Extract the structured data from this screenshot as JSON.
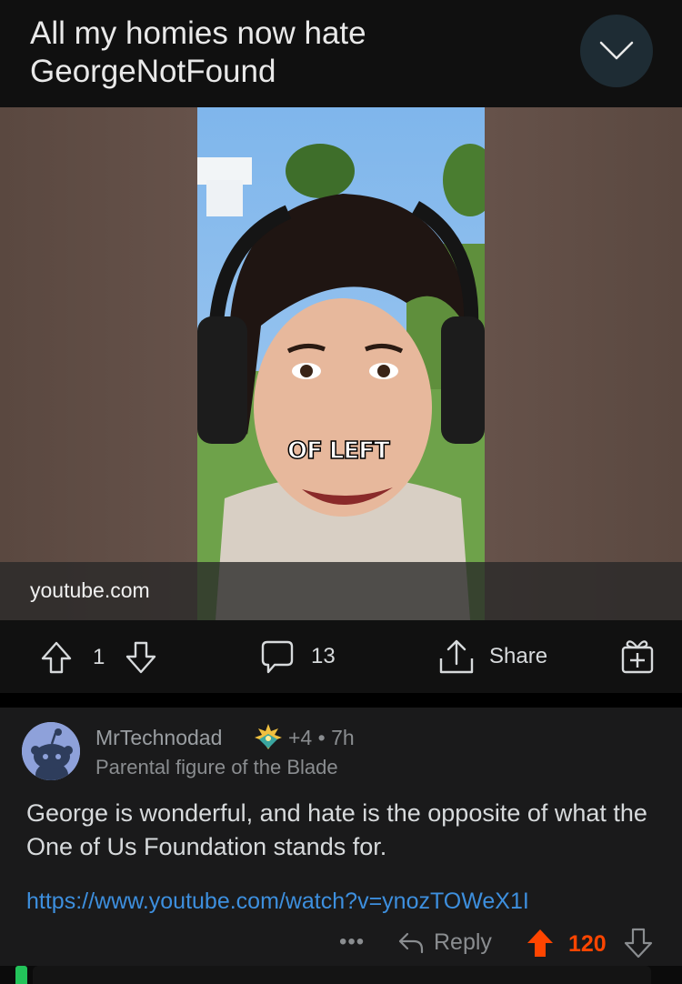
{
  "post": {
    "title": "All my homies now hate GeorgeNotFound",
    "link_domain": "youtube.com",
    "video_caption": "OF LEFT",
    "upvote_count": "1",
    "comment_count": "13",
    "share_label": "Share"
  },
  "comment": {
    "username": "MrTechnodad",
    "award_count": "+4",
    "age": "7h",
    "flair": "Parental figure of the Blade",
    "body": "George is wonderful, and hate is the opposite of what the One of Us Foundation stands for.",
    "url": "https://www.youtube.com/watch?v=ynozTOWeX1I",
    "more_label": "•••",
    "reply_label": "Reply",
    "score": "120"
  },
  "colors": {
    "background": "#000000",
    "surface": "#1a1a1b",
    "upvote_active": "#ff4500",
    "link": "#3d8fde",
    "thread_indicator": "#23c35a"
  }
}
